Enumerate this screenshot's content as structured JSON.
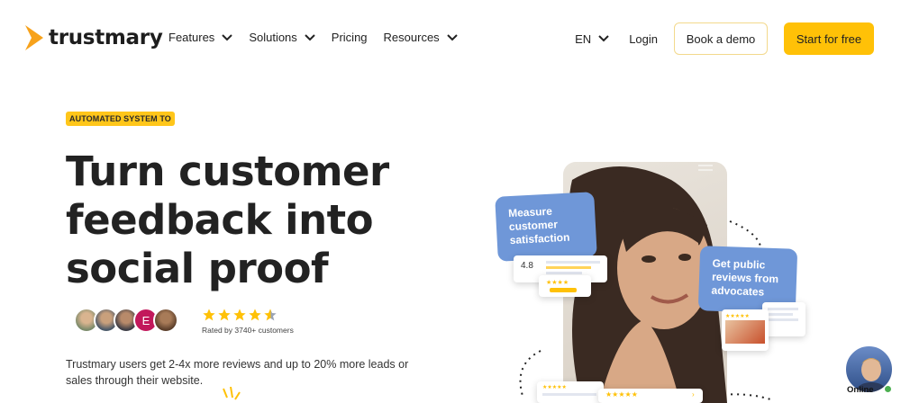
{
  "nav": {
    "logo_text": "trustmary",
    "menu": [
      {
        "label": "Features",
        "has_dropdown": true
      },
      {
        "label": "Solutions",
        "has_dropdown": true
      },
      {
        "label": "Pricing",
        "has_dropdown": false
      },
      {
        "label": "Resources",
        "has_dropdown": true
      }
    ],
    "language": "EN",
    "login_label": "Login",
    "demo_label": "Book a demo",
    "start_label": "Start for free"
  },
  "hero": {
    "badge": "AUTOMATED SYSTEM TO",
    "headline_line1": "Turn customer",
    "headline_line2": "feedback into",
    "headline_line3": "social proof",
    "avatar_letter": "E",
    "rating_text": "Rated by 3740+ customers",
    "stars_value": 4.5,
    "subtext": "Trustmary users get 2-4x more reviews and up to 20% more leads or sales through their website."
  },
  "visual": {
    "bubble1": "Measure customer satisfaction",
    "bubble2": "Get public reviews from advocates",
    "score": "4.8"
  },
  "chat": {
    "status": "Online"
  },
  "colors": {
    "accent": "#ffc107",
    "bubble": "#6f97d8",
    "brand_orange": "#f7a21b"
  }
}
